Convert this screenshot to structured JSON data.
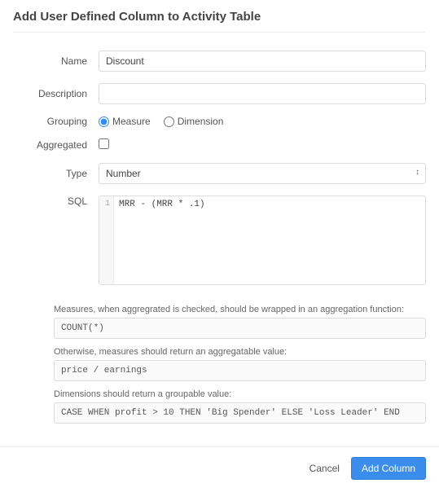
{
  "dialog": {
    "title": "Add User Defined Column to Activity Table"
  },
  "fields": {
    "name_label": "Name",
    "name_value": "Discount",
    "description_label": "Description",
    "description_value": "",
    "grouping_label": "Grouping",
    "grouping_option_measure": "Measure",
    "grouping_option_dimension": "Dimension",
    "aggregated_label": "Aggregated",
    "type_label": "Type",
    "type_value": "Number",
    "sql_label": "SQL",
    "sql_line_number": "1",
    "sql_value": "MRR - (MRR * .1)"
  },
  "hints": {
    "h1_label": "Measures, when aggregrated is checked, should be wrapped in an aggregation function:",
    "h1_code": "COUNT(*)",
    "h2_label": "Otherwise, measures should return an aggregatable value:",
    "h2_code": "price / earnings",
    "h3_label": "Dimensions should return a groupable value:",
    "h3_code": "CASE WHEN profit > 10 THEN 'Big Spender' ELSE 'Loss Leader' END"
  },
  "footer": {
    "cancel": "Cancel",
    "submit": "Add Column"
  }
}
